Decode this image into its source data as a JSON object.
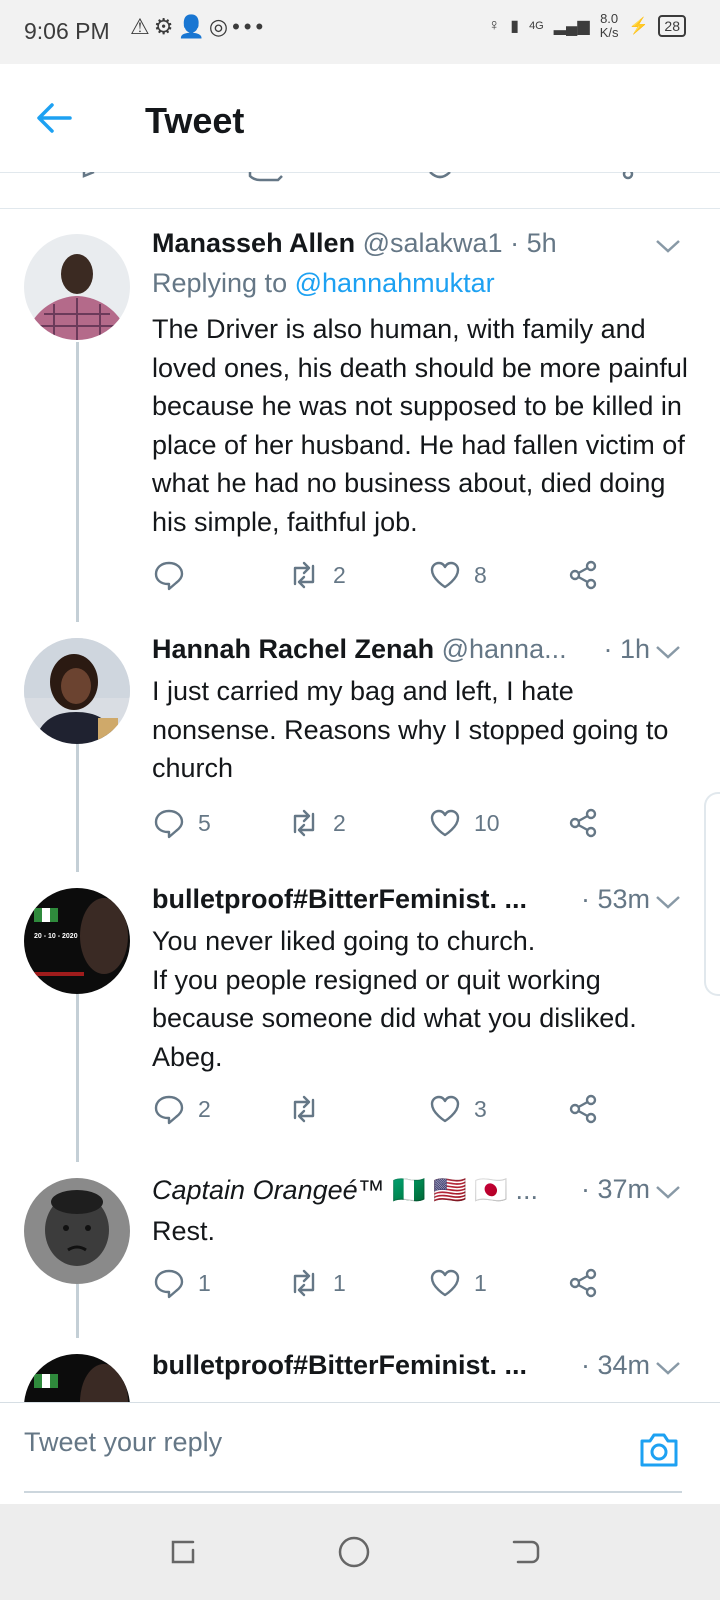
{
  "status_bar": {
    "time": "9:06 PM",
    "left_icons": [
      "warning-icon",
      "settings-icon",
      "add-user-icon",
      "instagram-icon",
      "more-icon"
    ],
    "net_speed_value": "8.0",
    "net_speed_unit": "K/s",
    "network": "4G",
    "battery": "28"
  },
  "header": {
    "title": "Tweet"
  },
  "tweets": [
    {
      "name": "Manasseh Allen",
      "handle": "@salakwa1",
      "time": "· 5h",
      "replying_prefix": "Replying to",
      "replying_to": "@hannahmuktar",
      "text": "The Driver is also human, with family and loved ones, his death should be more painful because he was not supposed to be killed in place of her husband. He had fallen victim of what he had no business about, died doing his simple, faithful job.",
      "replies": "",
      "retweets": "2",
      "likes": "8"
    },
    {
      "name": "Hannah Rachel Zenah",
      "handle": "@hanna...",
      "time": "· 1h",
      "text": "I just carried my bag and left, I hate nonsense. Reasons why I stopped going to church",
      "replies": "5",
      "retweets": "2",
      "likes": "10"
    },
    {
      "name": "bulletproof#BitterFeminist. ...",
      "handle": "",
      "time": "· 53m",
      "text": "You never liked going to church.\nIf you people resigned or quit working because someone did what you disliked.\nAbeg.",
      "avatar_text": "20 - 10 - 2020",
      "replies": "2",
      "retweets": "",
      "likes": "3"
    },
    {
      "name": "Captain Orangeé™",
      "flags": "🇳🇬 🇺🇸 🇯🇵 ...",
      "handle": "",
      "time": "· 37m",
      "text": "Rest.",
      "replies": "1",
      "retweets": "1",
      "likes": "1"
    },
    {
      "name": "bulletproof#BitterFeminist. ...",
      "handle": "",
      "time": "· 34m"
    }
  ],
  "reply_bar": {
    "placeholder": "Tweet your reply"
  },
  "colors": {
    "accent": "#1da1f2",
    "muted": "#657786",
    "text": "#14171a",
    "thread_line": "#c4cfd6"
  }
}
